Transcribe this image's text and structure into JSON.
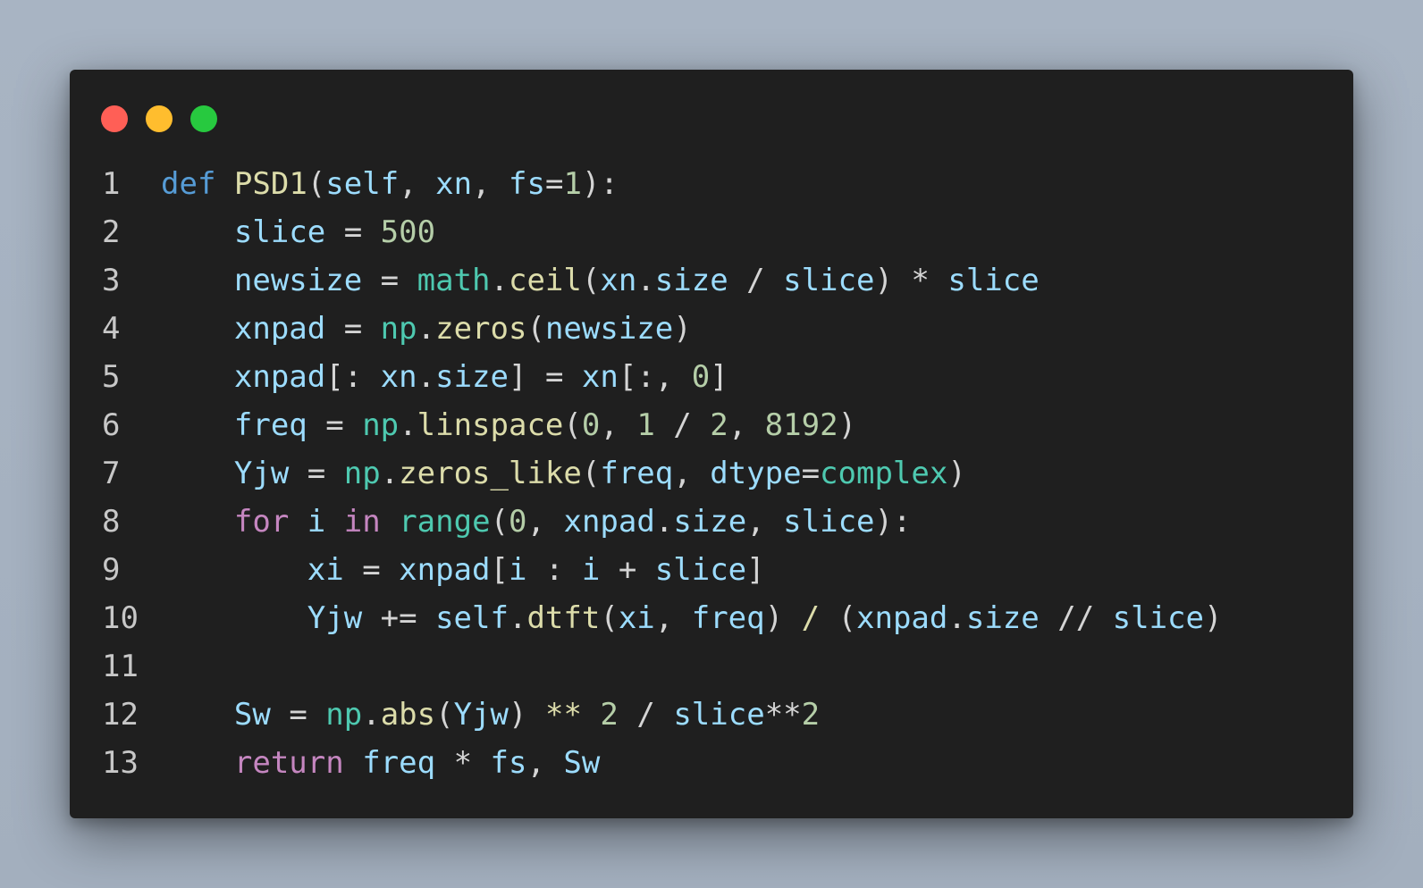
{
  "window": {
    "controls": [
      {
        "name": "close",
        "color": "#ff5f56"
      },
      {
        "name": "minimize",
        "color": "#ffbd2e"
      },
      {
        "name": "maximize",
        "color": "#27c93f"
      }
    ]
  },
  "code": {
    "language": "python",
    "lines": [
      {
        "number": "1",
        "tokens": [
          {
            "t": "def",
            "c": "kw"
          },
          {
            "t": " ",
            "c": "op"
          },
          {
            "t": "PSD1",
            "c": "fn"
          },
          {
            "t": "(",
            "c": "op"
          },
          {
            "t": "self",
            "c": "var"
          },
          {
            "t": ", ",
            "c": "op"
          },
          {
            "t": "xn",
            "c": "var"
          },
          {
            "t": ", ",
            "c": "op"
          },
          {
            "t": "fs",
            "c": "var"
          },
          {
            "t": "=",
            "c": "op"
          },
          {
            "t": "1",
            "c": "num"
          },
          {
            "t": "):",
            "c": "op"
          }
        ]
      },
      {
        "number": "2",
        "tokens": [
          {
            "t": "    ",
            "c": "op"
          },
          {
            "t": "slice",
            "c": "var"
          },
          {
            "t": " = ",
            "c": "op"
          },
          {
            "t": "500",
            "c": "num"
          }
        ]
      },
      {
        "number": "3",
        "tokens": [
          {
            "t": "    ",
            "c": "op"
          },
          {
            "t": "newsize",
            "c": "var"
          },
          {
            "t": " = ",
            "c": "op"
          },
          {
            "t": "math",
            "c": "mod"
          },
          {
            "t": ".",
            "c": "op"
          },
          {
            "t": "ceil",
            "c": "fn"
          },
          {
            "t": "(",
            "c": "op"
          },
          {
            "t": "xn",
            "c": "var"
          },
          {
            "t": ".",
            "c": "op"
          },
          {
            "t": "size",
            "c": "var"
          },
          {
            "t": " / ",
            "c": "op"
          },
          {
            "t": "slice",
            "c": "var"
          },
          {
            "t": ") * ",
            "c": "op"
          },
          {
            "t": "slice",
            "c": "var"
          }
        ]
      },
      {
        "number": "4",
        "tokens": [
          {
            "t": "    ",
            "c": "op"
          },
          {
            "t": "xnpad",
            "c": "var"
          },
          {
            "t": " = ",
            "c": "op"
          },
          {
            "t": "np",
            "c": "mod"
          },
          {
            "t": ".",
            "c": "op"
          },
          {
            "t": "zeros",
            "c": "fn"
          },
          {
            "t": "(",
            "c": "op"
          },
          {
            "t": "newsize",
            "c": "var"
          },
          {
            "t": ")",
            "c": "op"
          }
        ]
      },
      {
        "number": "5",
        "tokens": [
          {
            "t": "    ",
            "c": "op"
          },
          {
            "t": "xnpad",
            "c": "var"
          },
          {
            "t": "[: ",
            "c": "op"
          },
          {
            "t": "xn",
            "c": "var"
          },
          {
            "t": ".",
            "c": "op"
          },
          {
            "t": "size",
            "c": "var"
          },
          {
            "t": "] = ",
            "c": "op"
          },
          {
            "t": "xn",
            "c": "var"
          },
          {
            "t": "[:, ",
            "c": "op"
          },
          {
            "t": "0",
            "c": "num"
          },
          {
            "t": "]",
            "c": "op"
          }
        ]
      },
      {
        "number": "6",
        "tokens": [
          {
            "t": "    ",
            "c": "op"
          },
          {
            "t": "freq",
            "c": "var"
          },
          {
            "t": " = ",
            "c": "op"
          },
          {
            "t": "np",
            "c": "mod"
          },
          {
            "t": ".",
            "c": "op"
          },
          {
            "t": "linspace",
            "c": "fn"
          },
          {
            "t": "(",
            "c": "op"
          },
          {
            "t": "0",
            "c": "num"
          },
          {
            "t": ", ",
            "c": "op"
          },
          {
            "t": "1",
            "c": "num"
          },
          {
            "t": " / ",
            "c": "op"
          },
          {
            "t": "2",
            "c": "num"
          },
          {
            "t": ", ",
            "c": "op"
          },
          {
            "t": "8192",
            "c": "num"
          },
          {
            "t": ")",
            "c": "op"
          }
        ]
      },
      {
        "number": "7",
        "tokens": [
          {
            "t": "    ",
            "c": "op"
          },
          {
            "t": "Yjw",
            "c": "var"
          },
          {
            "t": " = ",
            "c": "op"
          },
          {
            "t": "np",
            "c": "mod"
          },
          {
            "t": ".",
            "c": "op"
          },
          {
            "t": "zeros_like",
            "c": "fn"
          },
          {
            "t": "(",
            "c": "op"
          },
          {
            "t": "freq",
            "c": "var"
          },
          {
            "t": ", ",
            "c": "op"
          },
          {
            "t": "dtype",
            "c": "var"
          },
          {
            "t": "=",
            "c": "op"
          },
          {
            "t": "complex",
            "c": "mod"
          },
          {
            "t": ")",
            "c": "op"
          }
        ]
      },
      {
        "number": "8",
        "tokens": [
          {
            "t": "    ",
            "c": "op"
          },
          {
            "t": "for",
            "c": "ctl"
          },
          {
            "t": " ",
            "c": "op"
          },
          {
            "t": "i",
            "c": "var"
          },
          {
            "t": " ",
            "c": "op"
          },
          {
            "t": "in",
            "c": "ctl"
          },
          {
            "t": " ",
            "c": "op"
          },
          {
            "t": "range",
            "c": "mod"
          },
          {
            "t": "(",
            "c": "op"
          },
          {
            "t": "0",
            "c": "num"
          },
          {
            "t": ", ",
            "c": "op"
          },
          {
            "t": "xnpad",
            "c": "var"
          },
          {
            "t": ".",
            "c": "op"
          },
          {
            "t": "size",
            "c": "var"
          },
          {
            "t": ", ",
            "c": "op"
          },
          {
            "t": "slice",
            "c": "var"
          },
          {
            "t": "):",
            "c": "op"
          }
        ]
      },
      {
        "number": "9",
        "tokens": [
          {
            "t": "        ",
            "c": "op"
          },
          {
            "t": "xi",
            "c": "var"
          },
          {
            "t": " = ",
            "c": "op"
          },
          {
            "t": "xnpad",
            "c": "var"
          },
          {
            "t": "[",
            "c": "op"
          },
          {
            "t": "i",
            "c": "var"
          },
          {
            "t": " : ",
            "c": "op"
          },
          {
            "t": "i",
            "c": "var"
          },
          {
            "t": " + ",
            "c": "op"
          },
          {
            "t": "slice",
            "c": "var"
          },
          {
            "t": "]",
            "c": "op"
          }
        ]
      },
      {
        "number": "10",
        "tokens": [
          {
            "t": "        ",
            "c": "op"
          },
          {
            "t": "Yjw",
            "c": "var"
          },
          {
            "t": " += ",
            "c": "op"
          },
          {
            "t": "self",
            "c": "var"
          },
          {
            "t": ".",
            "c": "op"
          },
          {
            "t": "dtft",
            "c": "fn"
          },
          {
            "t": "(",
            "c": "op"
          },
          {
            "t": "xi",
            "c": "var"
          },
          {
            "t": ", ",
            "c": "op"
          },
          {
            "t": "freq",
            "c": "var"
          },
          {
            "t": ") ",
            "c": "op"
          },
          {
            "t": "/",
            "c": "fn"
          },
          {
            "t": " (",
            "c": "op"
          },
          {
            "t": "xnpad",
            "c": "var"
          },
          {
            "t": ".",
            "c": "op"
          },
          {
            "t": "size",
            "c": "var"
          },
          {
            "t": " // ",
            "c": "op"
          },
          {
            "t": "slice",
            "c": "var"
          },
          {
            "t": ")",
            "c": "op"
          }
        ]
      },
      {
        "number": "11",
        "tokens": []
      },
      {
        "number": "12",
        "tokens": [
          {
            "t": "    ",
            "c": "op"
          },
          {
            "t": "Sw",
            "c": "var"
          },
          {
            "t": " = ",
            "c": "op"
          },
          {
            "t": "np",
            "c": "mod"
          },
          {
            "t": ".",
            "c": "op"
          },
          {
            "t": "abs",
            "c": "fn"
          },
          {
            "t": "(",
            "c": "op"
          },
          {
            "t": "Yjw",
            "c": "var"
          },
          {
            "t": ") ",
            "c": "op"
          },
          {
            "t": "**",
            "c": "fn"
          },
          {
            "t": " ",
            "c": "op"
          },
          {
            "t": "2",
            "c": "num"
          },
          {
            "t": " / ",
            "c": "op"
          },
          {
            "t": "slice",
            "c": "var"
          },
          {
            "t": "**",
            "c": "op"
          },
          {
            "t": "2",
            "c": "num"
          }
        ]
      },
      {
        "number": "13",
        "tokens": [
          {
            "t": "    ",
            "c": "op"
          },
          {
            "t": "return",
            "c": "ctl"
          },
          {
            "t": " ",
            "c": "op"
          },
          {
            "t": "freq",
            "c": "var"
          },
          {
            "t": " * ",
            "c": "op"
          },
          {
            "t": "fs",
            "c": "var"
          },
          {
            "t": ", ",
            "c": "op"
          },
          {
            "t": "Sw",
            "c": "var"
          }
        ]
      }
    ]
  }
}
